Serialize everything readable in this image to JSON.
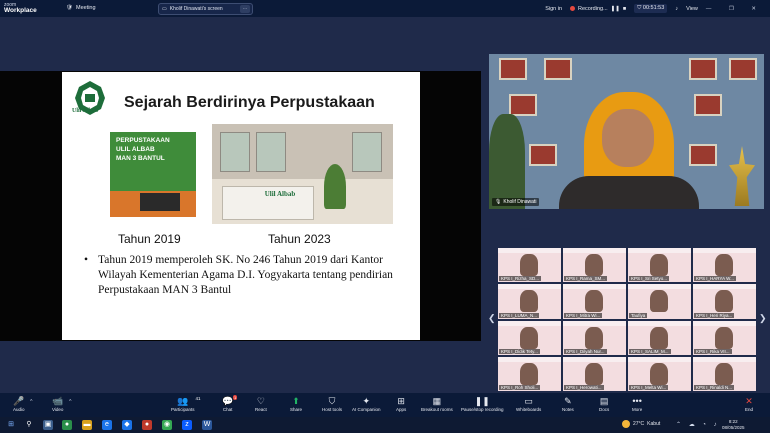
{
  "titlebar": {
    "brand_top": "zoom",
    "brand_bottom": "Workplace",
    "meeting_label": "Meeting",
    "screen_share_label": "Kholif Dinawati's screen",
    "signin_label": "Sign in",
    "recording_label": "Recording...",
    "timer": "00:51:53",
    "view_label": "View",
    "window_controls": "— ❐ ✕"
  },
  "slide": {
    "title": "Sejarah Berdirinya Perpustakaan",
    "logo_text": "Ulil Albab",
    "photo1_text_lines": [
      "PERPUSTAKAAN",
      "ULIL ALBAB",
      "MAN 3 BANTUL"
    ],
    "photo2_logo_text": "Ulil Albab",
    "caption1": "Tahun 2019",
    "caption2": "Tahun 2023",
    "bullet_symbol": "•",
    "bullet_text": "Tahun 2019  memperoleh SK. No 246 Tahun 2019 dari Kantor  Wilayah Kementerian Agama D.I. Yogyakarta tentang pendirian Perpustakaan MAN 3 Bantul"
  },
  "speaker": {
    "name": "Kholif Dinawati"
  },
  "gallery": {
    "tiles": [
      {
        "label": "KPS I_Rizha_SD..."
      },
      {
        "label": "KPS I_Rama_SM..."
      },
      {
        "label": "KPS I_Sri Setyo..."
      },
      {
        "label": "KPS I_HARYA W..."
      },
      {
        "label": "KPS I_LUMA_N..."
      },
      {
        "label": "KPS I_Mitra Wi..."
      },
      {
        "label": "Taufiya"
      },
      {
        "label": "KPS I_Heri Riya..."
      },
      {
        "label": "KPS I_Didik Tety..."
      },
      {
        "label": "KPS I_Dilyah Nur..."
      },
      {
        "label": "KPS I_SALIM_M..."
      },
      {
        "label": "KPS I_Rika VII..."
      },
      {
        "label": "KPS I_Roh Sholi..."
      },
      {
        "label": "KPS I_Herowati..."
      },
      {
        "label": "KPS I_Melta Wi..."
      },
      {
        "label": "KPS I_Rinaldi N..."
      }
    ],
    "prev_arrow": "❮",
    "next_arrow": "❯"
  },
  "controls": {
    "audio": "Audio",
    "video": "Video",
    "participants": "Participants",
    "participants_count": "41",
    "chat": "Chat",
    "chat_badge": "1",
    "react": "React",
    "share": "Share",
    "host_tools": "Host tools",
    "ai_companion": "AI Companion",
    "apps": "Apps",
    "breakout_rooms": "Breakout rooms",
    "pause_stop_recording": "Pause/stop recording",
    "whiteboards": "Whiteboards",
    "notes": "Notes",
    "docs": "Docs",
    "more": "More",
    "end": "End"
  },
  "taskbar": {
    "weather_temp": "27°C",
    "weather_text": "Kabut",
    "time": "8:22",
    "date": "08/05/2025"
  },
  "colors": {
    "zoom_blue": "#0b5cff",
    "recording_red": "#e5483f",
    "share_green": "#21b466",
    "title_bar": "#0b1a38",
    "stage_bg": "#1f2a4a"
  }
}
